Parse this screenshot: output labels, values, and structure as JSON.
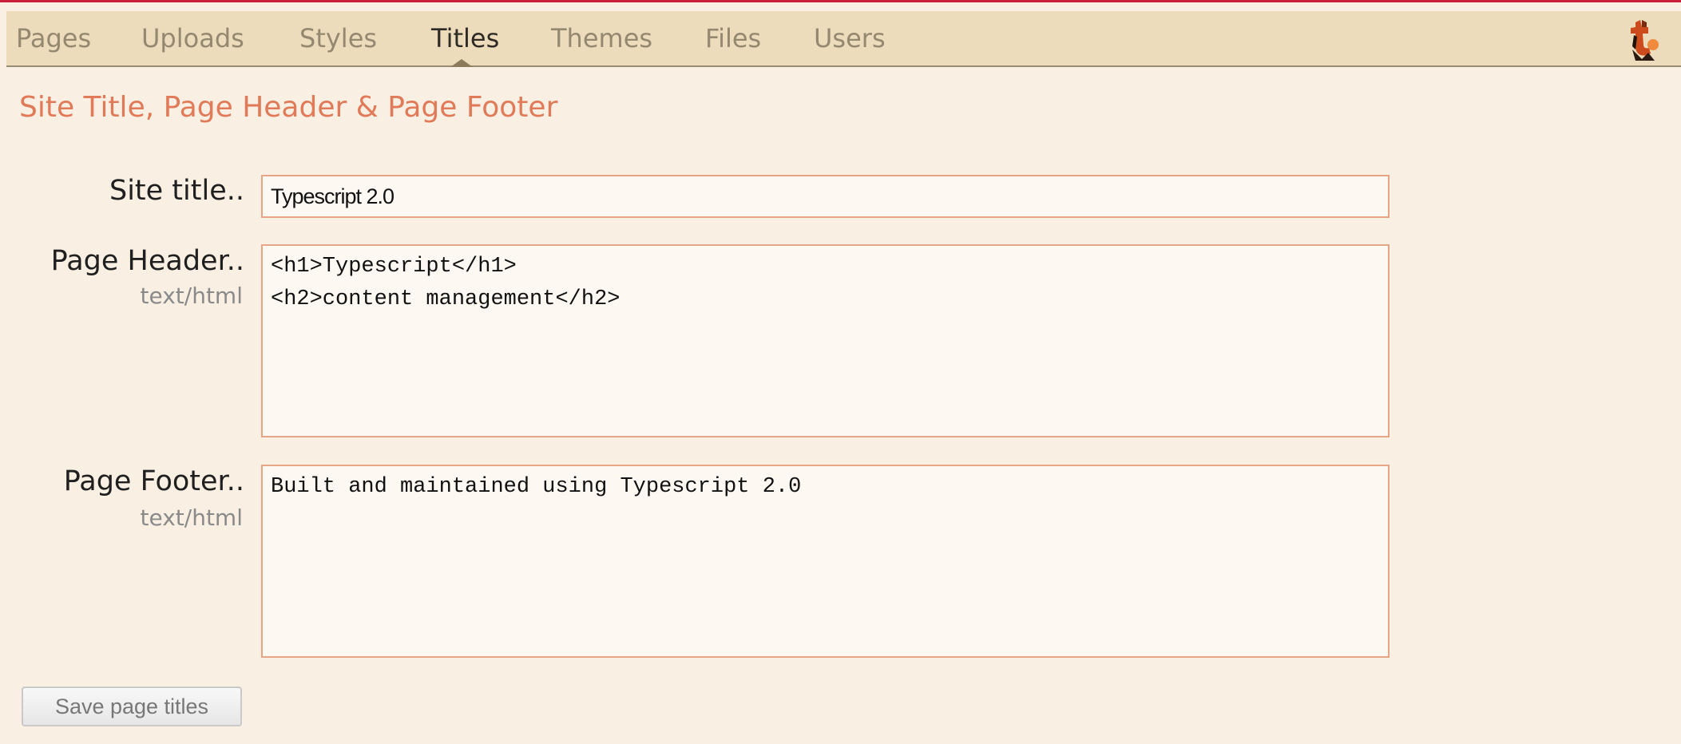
{
  "nav": {
    "tabs": [
      {
        "label": "Pages"
      },
      {
        "label": "Uploads"
      },
      {
        "label": "Styles"
      },
      {
        "label": "Titles",
        "active": true
      },
      {
        "label": "Themes"
      },
      {
        "label": "Files"
      },
      {
        "label": "Users"
      }
    ],
    "logo_icon": "typescript-logo-icon"
  },
  "page_title": "Site Title, Page Header & Page Footer",
  "form": {
    "site_title": {
      "label": "Site title..",
      "value": "Typescript 2.0"
    },
    "page_header": {
      "label": "Page Header..",
      "sublabel": "text/html",
      "value": "<h1>Typescript</h1>\n<h2>content management</h2>"
    },
    "page_footer": {
      "label": "Page Footer..",
      "sublabel": "text/html",
      "value": "Built and maintained using Typescript 2.0"
    },
    "save_label": "Save page titles"
  },
  "colors": {
    "accent": "#e07a58",
    "top_rule": "#c8203a",
    "nav_bg": "#ecdcbc",
    "page_bg": "#f9efe2",
    "field_border": "#e6a584"
  }
}
